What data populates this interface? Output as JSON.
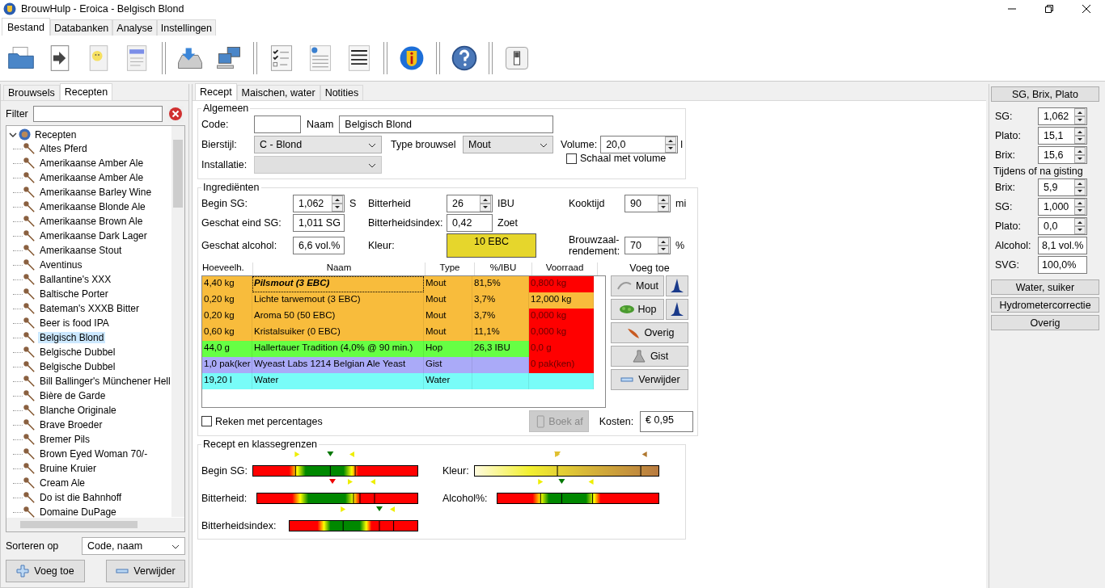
{
  "window": {
    "title": "BrouwHulp - Eroica - Belgisch Blond"
  },
  "ribbon_tabs": [
    {
      "label": "Bestand",
      "selected": true
    },
    {
      "label": "Databanken",
      "selected": false
    },
    {
      "label": "Analyse",
      "selected": false
    },
    {
      "label": "Instellingen",
      "selected": false
    }
  ],
  "left_tabs": [
    {
      "label": "Brouwsels",
      "selected": false
    },
    {
      "label": "Recepten",
      "selected": true
    }
  ],
  "filter": {
    "label": "Filter"
  },
  "tree": {
    "label": "Recepten",
    "expanded": true,
    "children": [
      {
        "label": "Altes Pferd",
        "selected": false
      },
      {
        "label": "Amerikaanse Amber Ale",
        "selected": false
      },
      {
        "label": "Amerikaanse Amber Ale",
        "selected": false
      },
      {
        "label": "Amerikaanse Barley Wine",
        "selected": false
      },
      {
        "label": "Amerikaanse Blonde Ale",
        "selected": false
      },
      {
        "label": "Amerikaanse Brown Ale",
        "selected": false
      },
      {
        "label": "Amerikaanse Dark Lager",
        "selected": false
      },
      {
        "label": "Amerikaanse Stout",
        "selected": false
      },
      {
        "label": "Aventinus",
        "selected": false
      },
      {
        "label": "Ballantine's XXX",
        "selected": false
      },
      {
        "label": "Baltische Porter",
        "selected": false
      },
      {
        "label": "Bateman's XXXB Bitter",
        "selected": false
      },
      {
        "label": "Beer is food IPA",
        "selected": false
      },
      {
        "label": "Belgisch Blond",
        "selected": true
      },
      {
        "label": "Belgische Dubbel",
        "selected": false
      },
      {
        "label": "Belgische Dubbel",
        "selected": false
      },
      {
        "label": "Bill Ballinger's Münchener Hell",
        "selected": false
      },
      {
        "label": "Bière de Garde",
        "selected": false
      },
      {
        "label": "Blanche Originale",
        "selected": false
      },
      {
        "label": "Brave Broeder",
        "selected": false
      },
      {
        "label": "Bremer Pils",
        "selected": false
      },
      {
        "label": "Brown Eyed Woman 70/-",
        "selected": false
      },
      {
        "label": "Bruine Kruier",
        "selected": false
      },
      {
        "label": "Cream Ale",
        "selected": false
      },
      {
        "label": "Do ist die Bahnhoff",
        "selected": false
      },
      {
        "label": "Domaine DuPage",
        "selected": false
      }
    ]
  },
  "sort": {
    "label": "Sorteren op",
    "value": "Code, naam"
  },
  "left_buttons": [
    {
      "label": "Voeg toe",
      "kind": "add"
    },
    {
      "label": "Verwijder",
      "kind": "remove"
    }
  ],
  "recipe_tabs": [
    {
      "label": "Recept",
      "selected": true
    },
    {
      "label": "Maischen, water",
      "selected": false
    },
    {
      "label": "Notities",
      "selected": false
    }
  ],
  "general": {
    "title": "Algemeen",
    "code_label": "Code:",
    "name_label": "Naam",
    "name_value": "Belgisch Blond",
    "style_label": "Bierstijl:",
    "style_value": "C - Blond",
    "type_label": "Type brouwsel",
    "type_value": "Mout",
    "volume_label": "Volume:",
    "volume_value": "20,0",
    "volume_unit": "l",
    "install_label": "Installatie:",
    "install_disabled": true,
    "scale_label": "Schaal met volume",
    "scale_checked": false
  },
  "ingredients": {
    "title": "Ingrediënten",
    "fields": [
      {
        "label": "Begin SG:",
        "value": "1,062",
        "unit": "S",
        "kind": "spin"
      },
      {
        "label": "Bitterheid",
        "value": "26",
        "unit": "IBU",
        "kind": "spin"
      },
      {
        "label": "Kooktijd",
        "value": "90",
        "unit": "mi",
        "kind": "spin"
      },
      {
        "label": "Geschat eind SG:",
        "value": "1,011 SG",
        "kind": "text"
      },
      {
        "label": "Bitterheidsindex:",
        "value": "0,42",
        "unit": "Zoet",
        "kind": "text"
      },
      {
        "label": "Geschat alcohol:",
        "value": "6,6 vol.%",
        "kind": "text"
      },
      {
        "label": "Kleur:",
        "value": "10 EBC",
        "kind": "color",
        "color": "#e6d62c"
      },
      {
        "label": "Brouwzaal-rendement:",
        "value": "70",
        "unit": "%",
        "kind": "spin"
      }
    ],
    "columns": [
      "Hoeveelh.",
      "Naam",
      "Type",
      "%/IBU",
      "Voorraad"
    ],
    "table_rows": [
      {
        "amount": "4,40 kg",
        "name": "Pilsmout (3 EBC)",
        "type": "Mout",
        "pct": "81,5%",
        "stock": "0,800 kg",
        "kind": "malt",
        "short": true,
        "selected": true
      },
      {
        "amount": "0,20 kg",
        "name": "Lichte tarwemout (3 EBC)",
        "type": "Mout",
        "pct": "3,7%",
        "stock": "12,000 kg",
        "kind": "malt",
        "short": false,
        "selected": false
      },
      {
        "amount": "0,20 kg",
        "name": "Aroma 50 (50 EBC)",
        "type": "Mout",
        "pct": "3,7%",
        "stock": "0,000 kg",
        "kind": "malt",
        "short": true,
        "selected": false
      },
      {
        "amount": "0,60 kg",
        "name": "Kristalsuiker (0 EBC)",
        "type": "Mout",
        "pct": "11,1%",
        "stock": "0,000 kg",
        "kind": "malt",
        "short": true,
        "selected": false
      },
      {
        "amount": "44,0 g",
        "name": "Hallertauer Tradition (4,0% @ 90 min.)",
        "type": "Hop",
        "pct": "26,3 IBU",
        "stock": "0,0 g",
        "kind": "hop",
        "short": true,
        "selected": false
      },
      {
        "amount": "1,0 pak(ker",
        "name": "Wyeast Labs 1214 Belgian Ale Yeast",
        "type": "Gist",
        "stock": "0 pak(ken)",
        "kind": "yeast",
        "short": true,
        "selected": false
      },
      {
        "amount": "19,20 l",
        "name": "Water",
        "type": "Water",
        "kind": "water",
        "short": false,
        "selected": false
      }
    ],
    "add_label": "Voeg toe",
    "add_buttons": [
      {
        "label": "Mout",
        "kind": "malt",
        "wizard": true
      },
      {
        "label": "Hop",
        "kind": "hop",
        "wizard": true
      },
      {
        "label": "Overig",
        "kind": "other",
        "wizard": false
      },
      {
        "label": "Gist",
        "kind": "yeast",
        "wizard": false
      },
      {
        "label": "Verwijder",
        "kind": "remove",
        "wizard": false
      }
    ],
    "percent_label": "Reken met percentages",
    "percent_checked": false,
    "book_label": "Boek af",
    "book_disabled": true,
    "cost_label": "Kosten:",
    "cost_value": "€ 0,95"
  },
  "classes": {
    "title": "Recept en klassegrenzen",
    "bars": [
      {
        "label": "Begin SG:",
        "kind": "range"
      },
      {
        "label": "Kleur:",
        "kind": "color"
      },
      {
        "label": "Bitterheid:",
        "kind": "range"
      },
      {
        "label": "Alcohol%:",
        "kind": "range"
      },
      {
        "label": "Bitterheidsindex:",
        "kind": "range"
      }
    ]
  },
  "calculator": {
    "title": "SG, Brix, Plato",
    "fields": [
      {
        "label": "SG:",
        "value": "1,062",
        "kind": "spin"
      },
      {
        "label": "Plato:",
        "value": "15,1",
        "kind": "spin"
      },
      {
        "label": "Brix:",
        "value": "15,6",
        "kind": "spin"
      },
      {
        "label": "Tijdens of na gisting",
        "kind": "heading"
      },
      {
        "label": "Brix:",
        "value": "5,9",
        "kind": "spin"
      },
      {
        "label": "SG:",
        "value": "1,000",
        "kind": "spin"
      },
      {
        "label": "Plato:",
        "value": "0,0",
        "kind": "spin"
      },
      {
        "label": "Alcohol:",
        "value": "8,1 vol.%",
        "kind": "text"
      },
      {
        "label": "SVG:",
        "value": "100,0%",
        "kind": "text"
      }
    ],
    "sections": [
      "Water, suiker",
      "Hydrometercorrectie",
      "Overig"
    ]
  }
}
